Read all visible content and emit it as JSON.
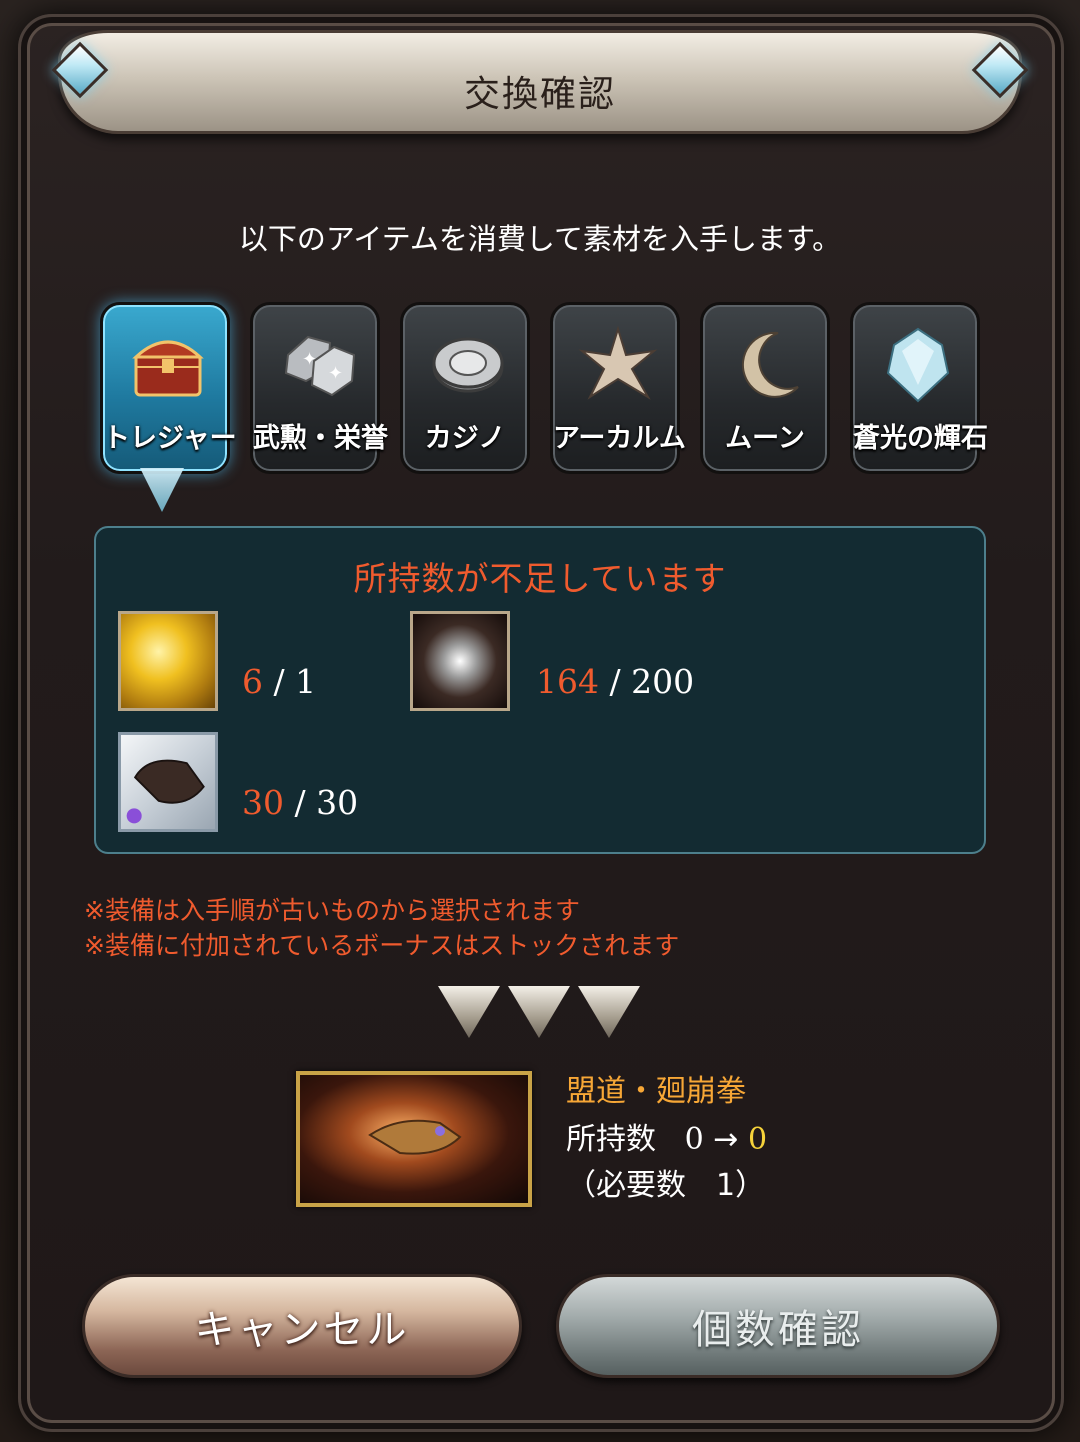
{
  "dialog": {
    "title": "交換確認",
    "subtitle": "以下のアイテムを消費して素材を入手します。"
  },
  "tabs": [
    {
      "label": "トレジャー",
      "icon": "treasure-chest-icon",
      "active": true
    },
    {
      "label": "武勲・栄誉",
      "icon": "dice-icon",
      "active": false
    },
    {
      "label": "カジノ",
      "icon": "casino-chip-icon",
      "active": false
    },
    {
      "label": "アーカルム",
      "icon": "star-burst-icon",
      "active": false
    },
    {
      "label": "ムーン",
      "icon": "crescent-moon-icon",
      "active": false
    },
    {
      "label": "蒼光の輝石",
      "icon": "crystal-icon",
      "active": false
    }
  ],
  "materials": {
    "warning": "所持数が不足しています",
    "items": [
      {
        "icon": "gold-bar-icon",
        "have": "6",
        "need": "1"
      },
      {
        "icon": "silver-orb-icon",
        "have": "164",
        "need": "200"
      },
      {
        "icon": "gauntlet-icon",
        "have": "30",
        "need": "30"
      }
    ]
  },
  "notes": [
    "※装備は入手順が古いものから選択されます",
    "※装備に付加されているボーナスはストックされます"
  ],
  "result": {
    "name": "盟道・廻崩拳",
    "own_label": "所持数",
    "own_before": "0",
    "arrow": "→",
    "own_after": "0",
    "need_text": "（必要数　1）"
  },
  "buttons": {
    "cancel": "キャンセル",
    "confirm": "個数確認"
  },
  "colors": {
    "warning": "#f05b2e",
    "result_name": "#f7a736",
    "accent_blue": "#3aa9cf"
  }
}
